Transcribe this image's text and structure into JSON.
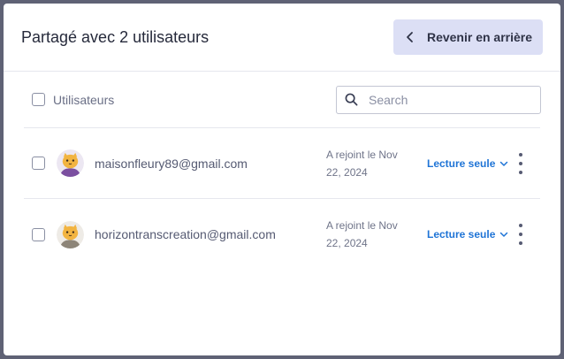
{
  "dialog": {
    "title": "Partagé avec 2 utilisateurs",
    "back_label": "Revenir en arrière"
  },
  "list_header": {
    "column_label": "Utilisateurs",
    "search_placeholder": "Search"
  },
  "users": [
    {
      "email": "maisonfleury89@gmail.com",
      "joined": "A rejoint le Nov 22, 2024",
      "role": "Lecture seule",
      "avatar_ring": "#7b4fa0"
    },
    {
      "email": "horizontranscreation@gmail.com",
      "joined": "A rejoint le Nov 22, 2024",
      "role": "Lecture seule",
      "avatar_ring": "#8d8578"
    }
  ],
  "colors": {
    "accent": "#1f74d6",
    "button_bg": "#dcdff5",
    "backdrop": "#5f6275"
  }
}
